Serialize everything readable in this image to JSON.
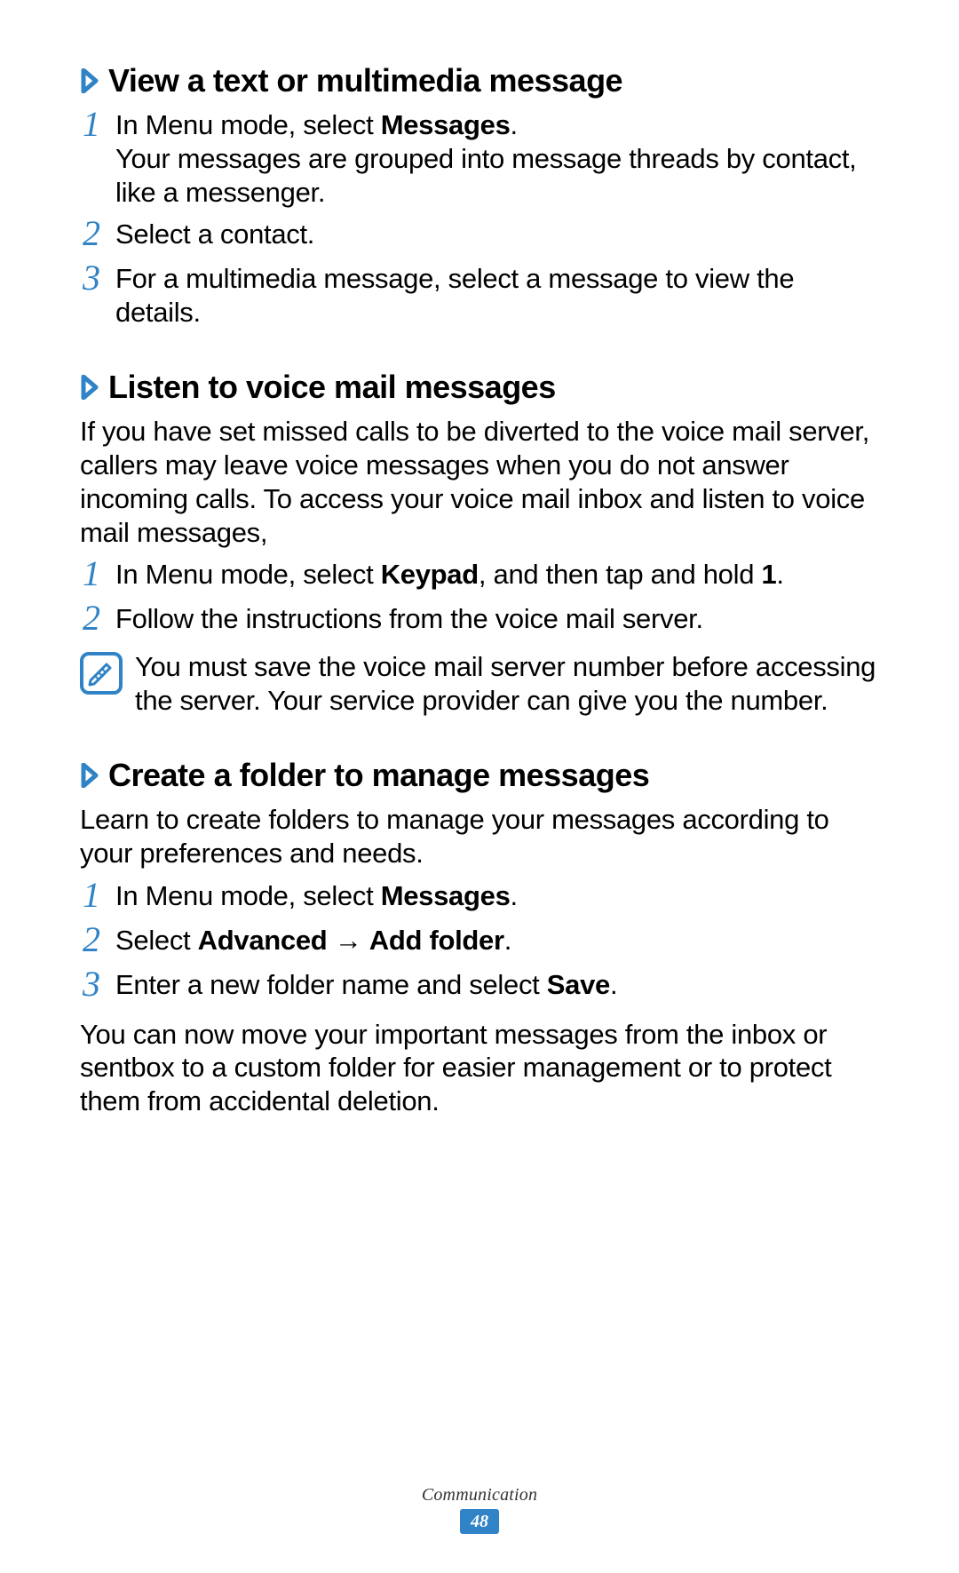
{
  "sections": [
    {
      "heading": "View a text or multimedia message",
      "steps": [
        {
          "num": "1",
          "parts": [
            {
              "t": "In Menu mode, select ",
              "b": false
            },
            {
              "t": "Messages",
              "b": true
            },
            {
              "t": ".",
              "b": false
            }
          ],
          "extra": "Your messages are grouped into message threads by contact, like a messenger."
        },
        {
          "num": "2",
          "parts": [
            {
              "t": "Select a contact.",
              "b": false
            }
          ]
        },
        {
          "num": "3",
          "parts": [
            {
              "t": "For a multimedia message, select a message to view the details.",
              "b": false
            }
          ]
        }
      ]
    },
    {
      "heading": "Listen to voice mail messages",
      "intro": "If you have set missed calls to be diverted to the voice mail server, callers may leave voice messages when you do not answer incoming calls. To access your voice mail inbox and listen to voice mail messages,",
      "steps": [
        {
          "num": "1",
          "parts": [
            {
              "t": "In Menu mode, select ",
              "b": false
            },
            {
              "t": "Keypad",
              "b": true
            },
            {
              "t": ", and then tap and hold ",
              "b": false
            },
            {
              "t": "1",
              "b": true
            },
            {
              "t": ".",
              "b": false
            }
          ]
        },
        {
          "num": "2",
          "parts": [
            {
              "t": "Follow the instructions from the voice mail server.",
              "b": false
            }
          ]
        }
      ],
      "note": "You must save the voice mail server number before accessing the server. Your service provider can give you the number."
    },
    {
      "heading": "Create a folder to manage messages",
      "intro": "Learn to create folders to manage your messages according to your preferences and needs.",
      "steps": [
        {
          "num": "1",
          "parts": [
            {
              "t": "In Menu mode, select ",
              "b": false
            },
            {
              "t": "Messages",
              "b": true
            },
            {
              "t": ".",
              "b": false
            }
          ]
        },
        {
          "num": "2",
          "parts": [
            {
              "t": "Select ",
              "b": false
            },
            {
              "t": "Advanced",
              "b": true
            },
            {
              "t": " → ",
              "b": false,
              "arrow": true
            },
            {
              "t": "Add folder",
              "b": true
            },
            {
              "t": ".",
              "b": false
            }
          ]
        },
        {
          "num": "3",
          "parts": [
            {
              "t": "Enter a new folder name and select ",
              "b": false
            },
            {
              "t": "Save",
              "b": true
            },
            {
              "t": ".",
              "b": false
            }
          ]
        }
      ],
      "outro": "You can now move your important messages from the inbox or sentbox to a custom folder for easier management or to protect them from accidental deletion."
    }
  ],
  "footer": {
    "label": "Communication",
    "page": "48"
  }
}
